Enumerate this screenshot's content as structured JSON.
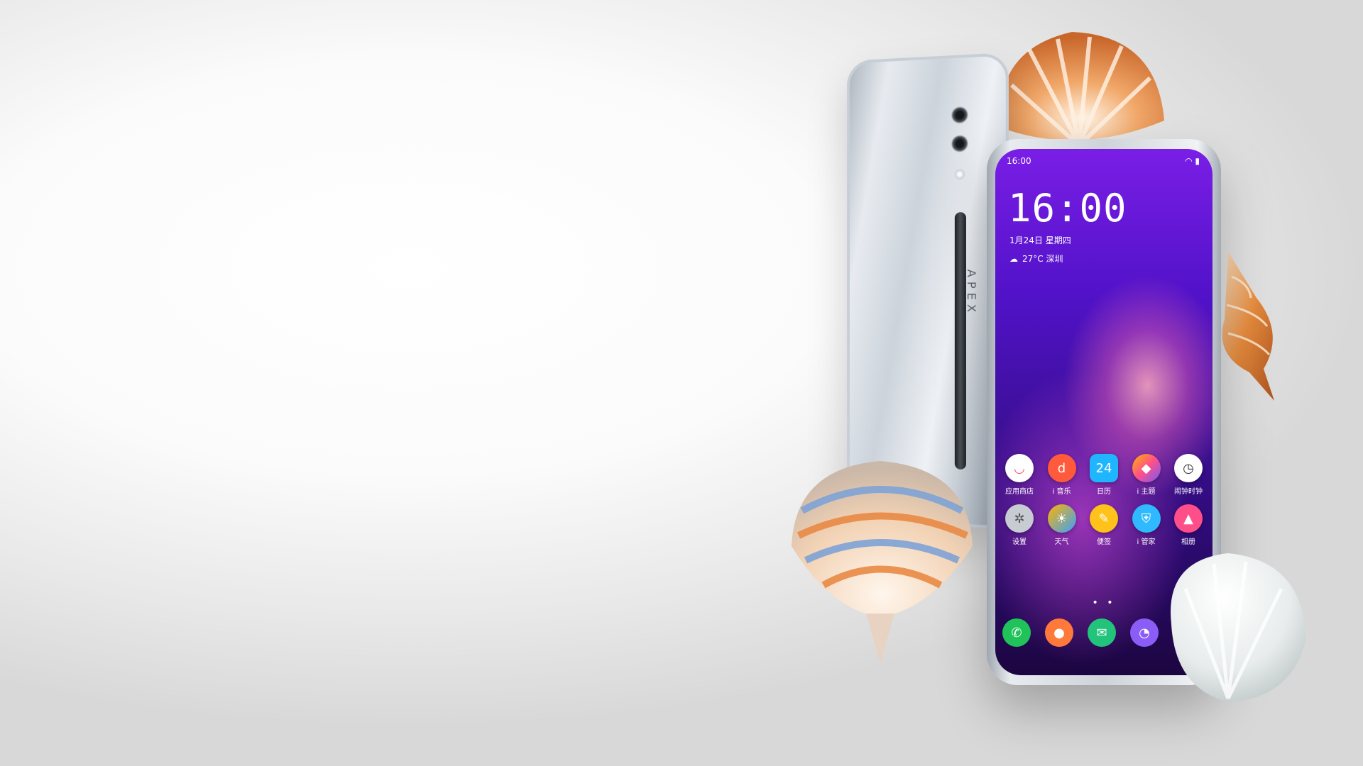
{
  "back_phone": {
    "brand_text": "APEX"
  },
  "front_phone": {
    "status_time": "16:00",
    "clock": "16:00",
    "date": "1月24日 星期四",
    "weather": "27°C 深圳",
    "apps_row1": [
      {
        "label": "应用商店",
        "icon": "store-icon",
        "color": "#ffffff"
      },
      {
        "label": "i 音乐",
        "icon": "music-icon",
        "color": "#ff5a3c"
      },
      {
        "label": "日历",
        "icon": "calendar-icon",
        "color": "#1fb6ff",
        "badge": "24"
      },
      {
        "label": "i 主题",
        "icon": "theme-icon",
        "color": "#ffffff"
      },
      {
        "label": "闹钟时钟",
        "icon": "clock-icon",
        "color": "#ffffff"
      }
    ],
    "apps_row2": [
      {
        "label": "设置",
        "icon": "settings-icon",
        "color": "#c7ccd2"
      },
      {
        "label": "天气",
        "icon": "weather-icon",
        "color": "#3aa0ff"
      },
      {
        "label": "便签",
        "icon": "notes-icon",
        "color": "#ffc21a"
      },
      {
        "label": "i 管家",
        "icon": "shield-icon",
        "color": "#2fb9ff"
      },
      {
        "label": "相册",
        "icon": "gallery-icon",
        "color": "#ff4f8a"
      }
    ],
    "dock": [
      {
        "icon": "phone-icon",
        "color": "#20c35a"
      },
      {
        "icon": "contacts-icon",
        "color": "#ff7a3a"
      },
      {
        "icon": "messages-icon",
        "color": "#22c37b"
      },
      {
        "icon": "browser-icon",
        "color": "#8b5cf6"
      },
      {
        "icon": "camera-icon",
        "color": "#1a1a1a"
      }
    ]
  },
  "colors": {
    "screen_top": "#7a1ee6",
    "screen_bottom": "#1c0640",
    "background": "#f4f4f4"
  }
}
